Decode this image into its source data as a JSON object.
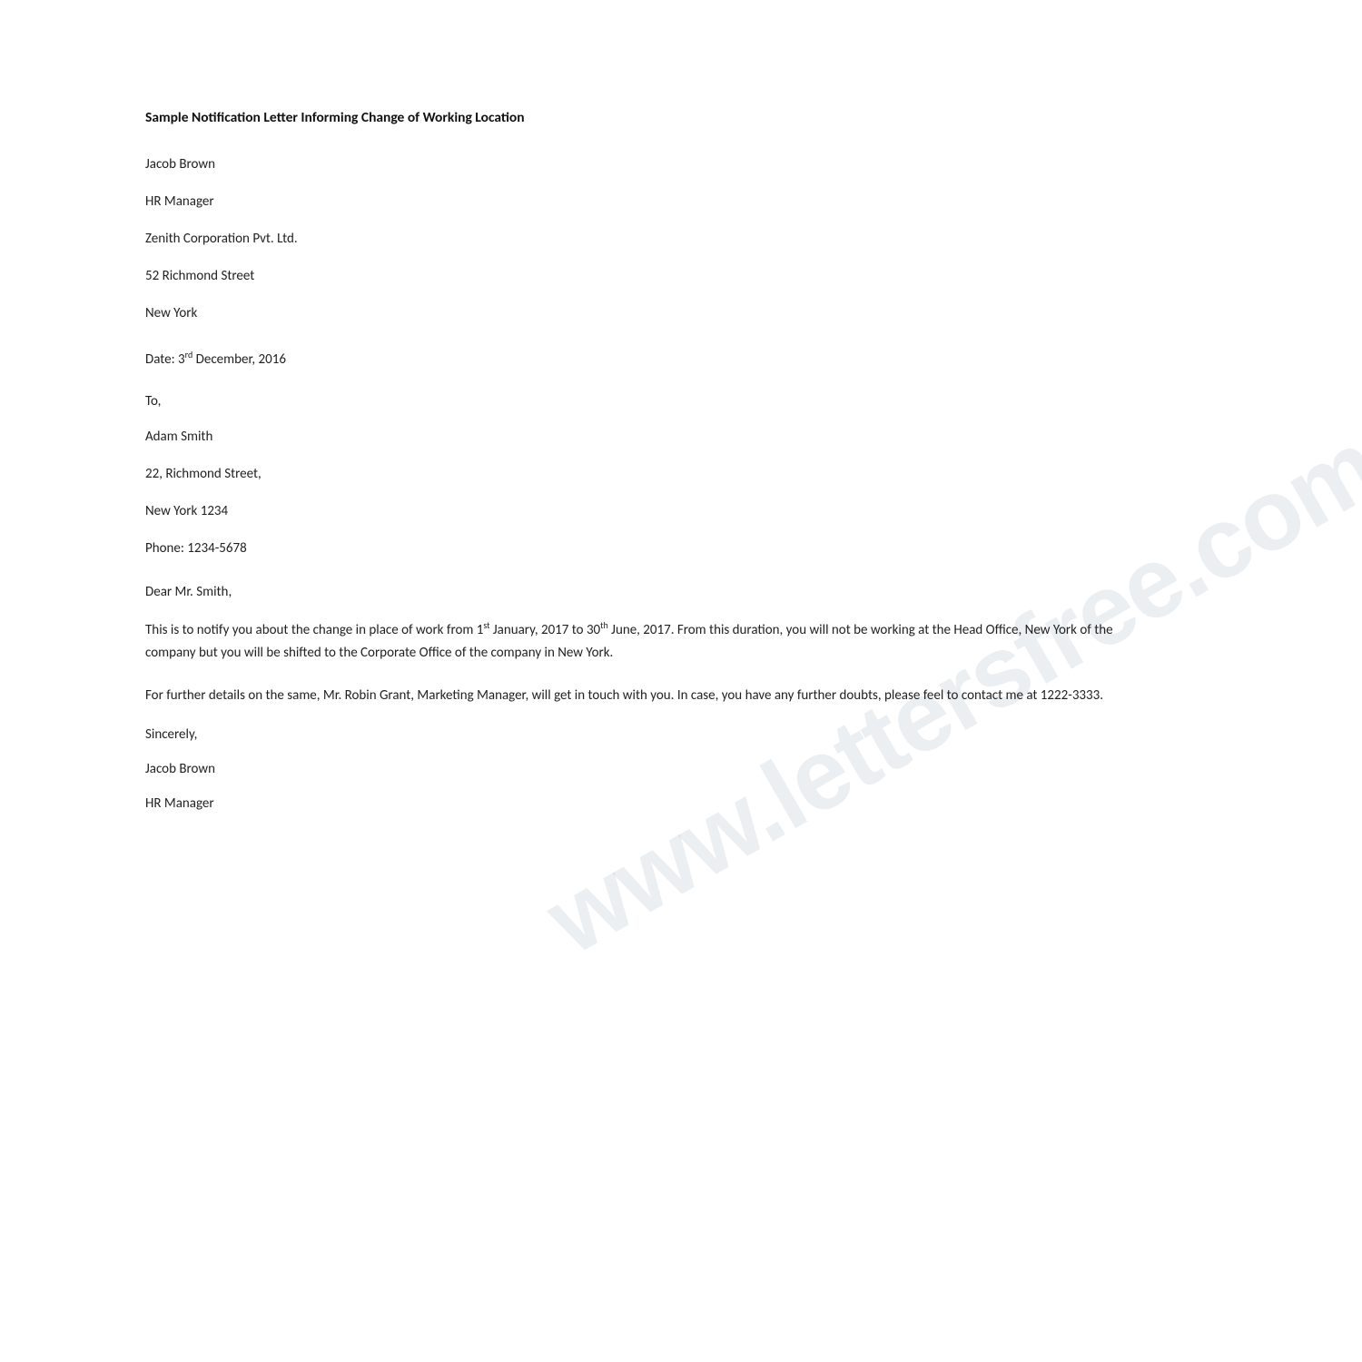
{
  "page": {
    "title": "Sample Notification Letter Informing Change of Working Location",
    "watermark": "www.lettersfree.com"
  },
  "sender": {
    "name": "Jacob Brown",
    "title": "HR Manager",
    "company": "Zenith Corporation Pvt. Ltd.",
    "street": "52 Richmond Street",
    "city": "New York"
  },
  "date": {
    "label": "Date: ",
    "day": "3",
    "day_suffix": "rd",
    "rest": " December, 2016"
  },
  "to_label": "To,",
  "recipient": {
    "name": "Adam Smith",
    "street": "22, Richmond Street,",
    "city_zip": "New York 1234",
    "phone_label": "Phone: ",
    "phone": "1234-5678"
  },
  "salutation": "Dear Mr. Smith,",
  "body": {
    "paragraph1": "This is to notify you about the change in place of work from 1st January, 2017 to 30th June, 2017. From this duration, you will not be working at the Head Office, New York of the company but you will be shifted to the Corporate Office of the company in New York.",
    "paragraph2": "For further details on the same, Mr. Robin Grant, Marketing Manager, will get in touch with you. In case, you have any further doubts, please feel to contact me at 1222-3333."
  },
  "closing": "Sincerely,",
  "signature": {
    "name": "Jacob Brown",
    "title": "HR Manager"
  }
}
